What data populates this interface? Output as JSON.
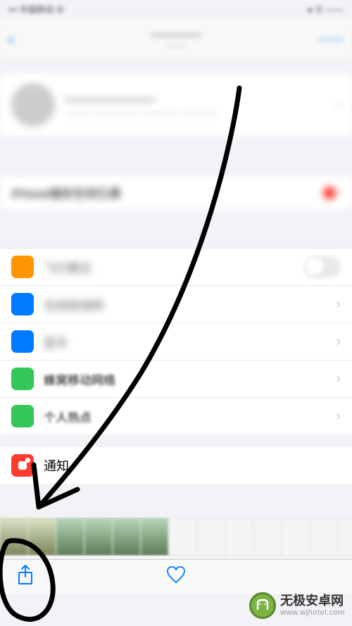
{
  "status": {
    "left": "••• 中国移动 ⊕",
    "right": "● ⦿ ───"
  },
  "header": {
    "back": "‹",
    "title_line1": "──────",
    "title_line2": "───",
    "action": "───"
  },
  "profile": {
    "name": "─────────",
    "sub": "──── ── ────── ────── ──────"
  },
  "storage": {
    "label": "iPhone储存空间已满"
  },
  "menu": {
    "items": [
      {
        "label": "飞行模式",
        "iconClass": "ic-orange",
        "control": "toggle"
      },
      {
        "label": "无线局域网",
        "iconClass": "ic-blue",
        "control": "chev"
      },
      {
        "label": "蓝牙",
        "iconClass": "ic-blue2",
        "control": "chev"
      },
      {
        "label": "蜂窝移动网络",
        "iconClass": "ic-green",
        "control": "chev"
      },
      {
        "label": "个人热点",
        "iconClass": "ic-green2",
        "control": "chev"
      }
    ]
  },
  "notif": {
    "label": "通知"
  },
  "toolbar": {
    "share": "⤴",
    "like": "♡"
  },
  "watermark": {
    "name": "无极安卓网",
    "url": "www.wjhotel.com"
  }
}
